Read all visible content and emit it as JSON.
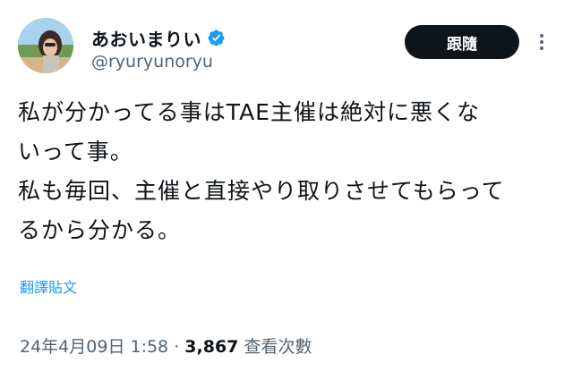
{
  "author": {
    "display_name": "あおいまりい",
    "handle": "@ryuryunoryu",
    "verified": true,
    "verified_color": "#1d9bf0"
  },
  "follow_button": {
    "label": "跟隨"
  },
  "more_icon": "more-vertical-icon",
  "tweet": {
    "lines": [
      "私が分かってる事はTAE主催は絶対に悪くな",
      "いって事。",
      "私も毎回、主催と直接やり取りさせてもらって",
      "るから分かる。"
    ]
  },
  "translate_label": "翻譯貼文",
  "meta": {
    "timestamp": "24年4月09日 1:58",
    "separator": "·",
    "views_count": "3,867",
    "views_label": "查看次數"
  },
  "colors": {
    "text": "#0f1419",
    "secondary": "#536471",
    "link": "#1d9bf0",
    "button_bg": "#0f1419"
  }
}
